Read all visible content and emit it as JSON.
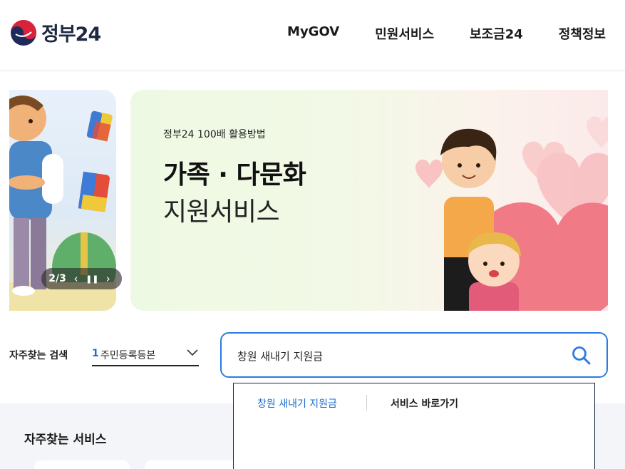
{
  "header": {
    "logo_text": "정부24",
    "nav": [
      "MyGOV",
      "민원서비스",
      "보조금24",
      "정책정보"
    ]
  },
  "banner": {
    "eyebrow": "정부24 100배 활용방법",
    "title": "가족 · 다문화",
    "subtitle": "지원서비스",
    "slide_counter": "2/3"
  },
  "search": {
    "frequent_label": "자주찾는 검색",
    "frequent_rank": "1",
    "frequent_term": "주민등록등본",
    "query": "창원 새내기 지원금"
  },
  "autocomplete": {
    "suggestion": "창원 새내기 지원금",
    "shortcut_label": "서비스 바로가기"
  },
  "services": {
    "title": "자주찾는 서비스"
  },
  "colors": {
    "accent_blue": "#2b7be4",
    "logo_red": "#d9233b",
    "logo_navy": "#1e2a5a",
    "heart_pink": "#f07a86"
  }
}
